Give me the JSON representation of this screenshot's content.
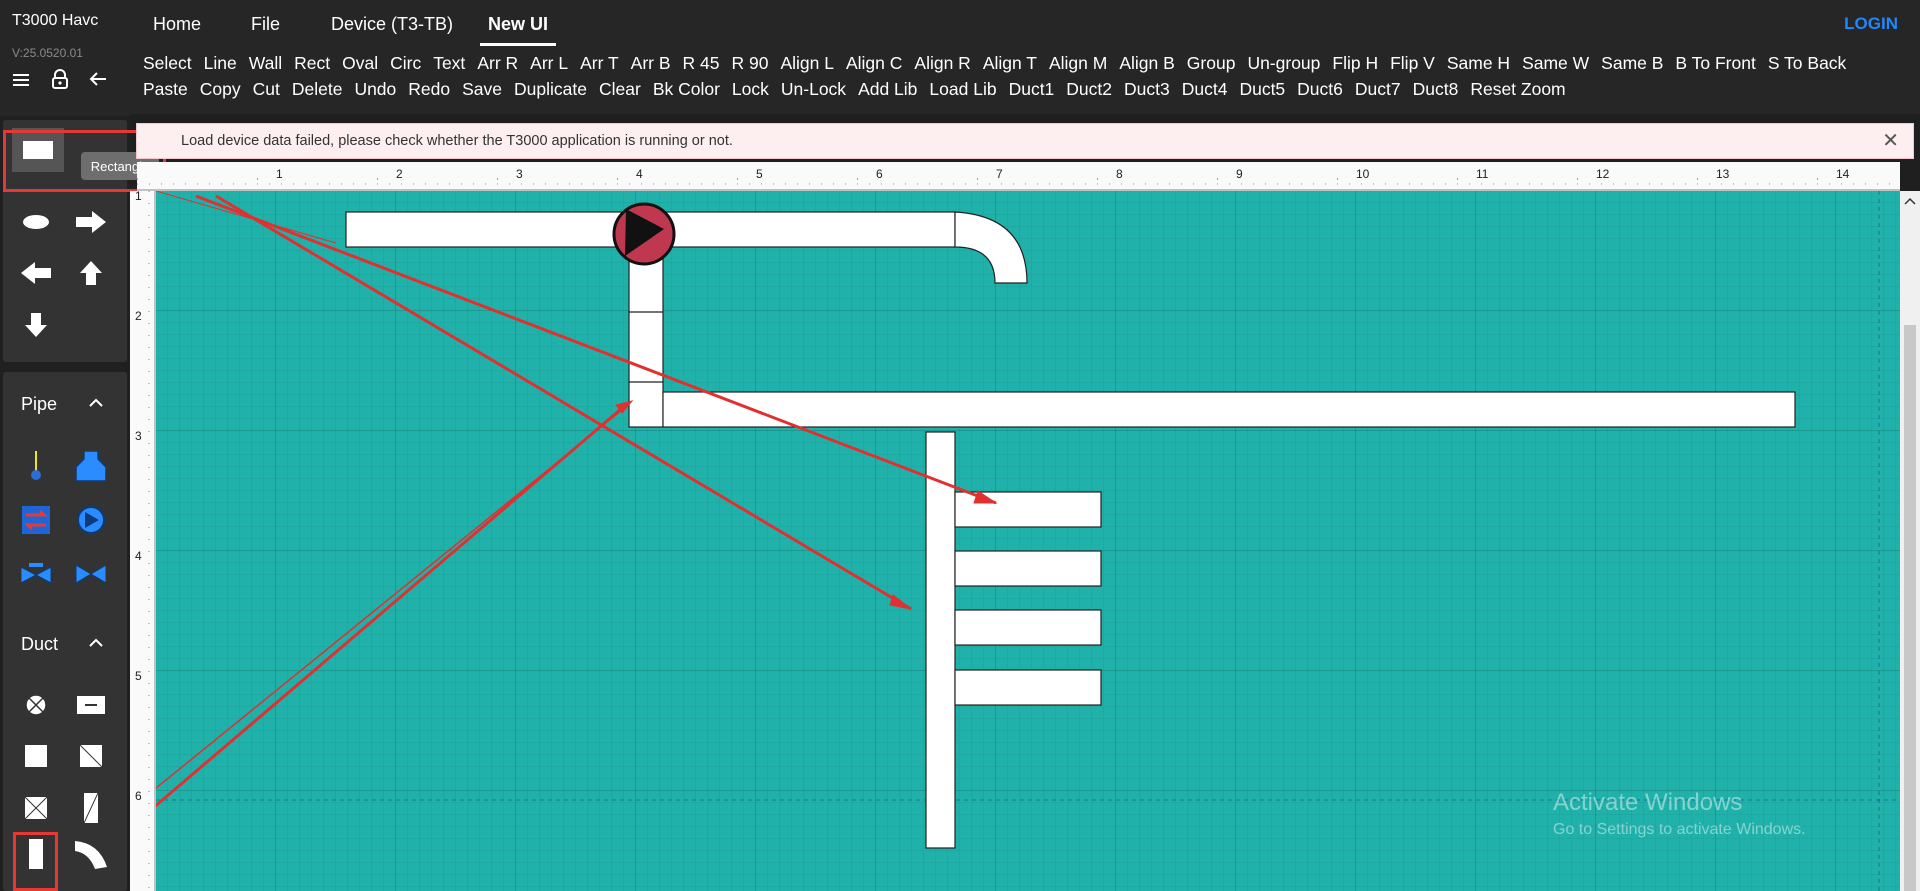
{
  "app": {
    "title": "T3000 Havc",
    "version": "V:25.0520.01"
  },
  "nav": {
    "tabs": [
      "Home",
      "File",
      "Device (T3-TB)",
      "New UI"
    ],
    "active": "New UI",
    "login": "LOGIN"
  },
  "toolbar": {
    "row1": [
      "Select",
      "Line",
      "Wall",
      "Rect",
      "Oval",
      "Circ",
      "Text",
      "Arr R",
      "Arr L",
      "Arr T",
      "Arr B",
      "R 45",
      "R 90",
      "Align L",
      "Align C",
      "Align R",
      "Align T",
      "Align M",
      "Align B",
      "Group",
      "Un-group",
      "Flip H",
      "Flip V",
      "Same H",
      "Same W",
      "Same B",
      "B To Front",
      "S To Back"
    ],
    "row2": [
      "Paste",
      "Copy",
      "Cut",
      "Delete",
      "Undo",
      "Redo",
      "Save",
      "Duplicate",
      "Clear",
      "Bk Color",
      "Lock",
      "Un-Lock",
      "Add Lib",
      "Load Lib",
      "Duct1",
      "Duct2",
      "Duct3",
      "Duct4",
      "Duct5",
      "Duct6",
      "Duct7",
      "Duct8",
      "Reset Zoom"
    ]
  },
  "sidebar": {
    "icons": [
      "menu-icon",
      "lock-icon",
      "back-arrow-icon"
    ],
    "sections": [
      {
        "title": "Pipe",
        "items": [
          "thermometer-icon",
          "tank-icon",
          "heat-exchanger-icon",
          "pump-icon",
          "valve-icon",
          "butterfly-valve-icon"
        ]
      },
      {
        "title": "Duct",
        "items": [
          "damper-icon",
          "duct-segment-icon",
          "square-duct-icon",
          "diagonal-duct-icon",
          "cross-duct-icon",
          "vertical-diagonal-duct-icon",
          "vertical-duct-icon",
          "elbow-duct-icon"
        ]
      }
    ],
    "tooltip": "Rectangle"
  },
  "alert": {
    "message": "Load device data failed, please check whether the T3000 application is running or not."
  },
  "ruler": {
    "top": [
      "1",
      "2",
      "3",
      "4",
      "5",
      "6",
      "7",
      "8",
      "9",
      "10",
      "11",
      "12",
      "13",
      "14"
    ],
    "left": [
      "1",
      "2",
      "3",
      "4",
      "5",
      "6"
    ]
  },
  "watermark": {
    "line1": "Activate Windows",
    "line2": "Go to Settings to activate Windows."
  },
  "colors": {
    "canvas": "#20b2aa",
    "annotation": "#e03030",
    "login": "#1e88ff",
    "pump": "#c0384f"
  }
}
